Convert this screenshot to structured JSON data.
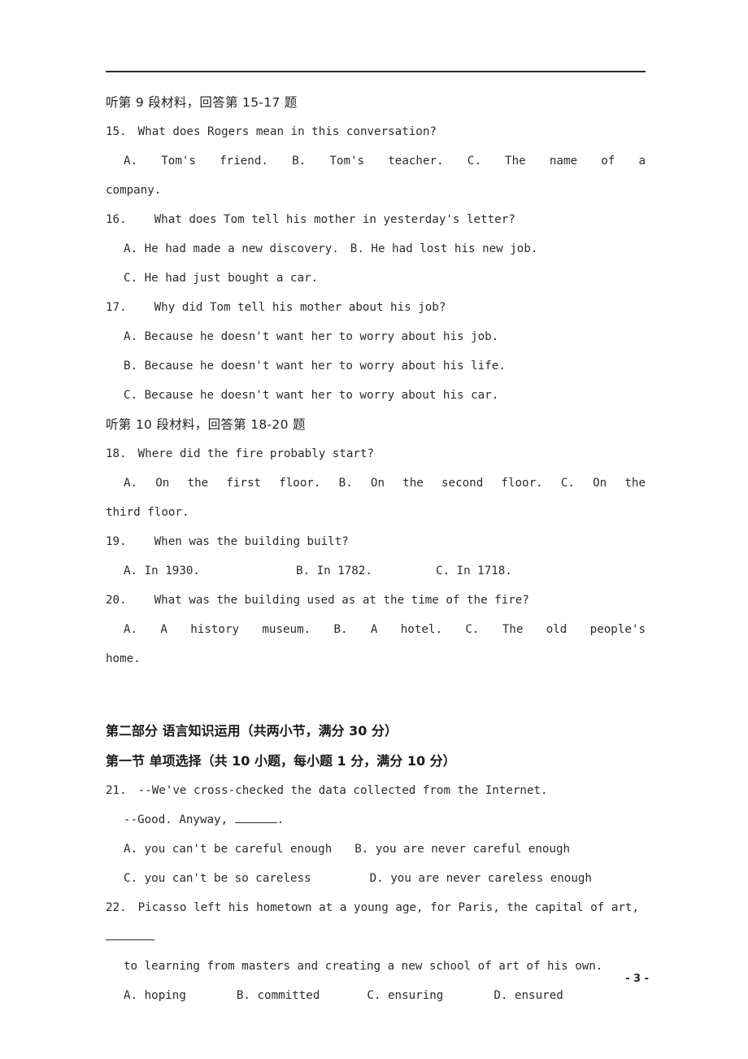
{
  "document": {
    "type": "english-exam-paper",
    "page_number": "- 3 -"
  },
  "listening": {
    "section_9": {
      "heading": "听第 9 段材料，回答第 15-17 题",
      "questions": [
        {
          "number": "15.",
          "stem": "What does Rogers mean in this conversation?",
          "options_line1": [
            "A. Tom's friend.",
            "B. Tom's teacher.",
            "C. The name of a"
          ],
          "options_wrap": "company."
        },
        {
          "number": "16.",
          "stem": "What does Tom tell his mother in yesterday's letter?",
          "options_line1": [
            "A. He had made a new discovery.",
            "B. He had lost his new job."
          ],
          "options_line2": [
            "C. He had just bought a car."
          ]
        },
        {
          "number": "17.",
          "stem": "Why did Tom tell his mother about his job?",
          "option_a": "A. Because he doesn't want her to worry about his job.",
          "option_b": "B. Because he doesn't want her to worry about his life.",
          "option_c": "C. Because he doesn't want her to worry about his car."
        }
      ]
    },
    "section_10": {
      "heading": "听第 10 段材料，回答第 18-20 题",
      "questions": [
        {
          "number": "18.",
          "stem": "Where did the fire probably start?",
          "options_line1": [
            "A. On the first floor.",
            "B. On the second floor.",
            "C.   On   the"
          ],
          "options_wrap": "third floor."
        },
        {
          "number": "19.",
          "stem": "When was the building built?",
          "options_line1": [
            "A. In 1930.",
            "B. In 1782.",
            "C. In 1718."
          ]
        },
        {
          "number": "20.",
          "stem": "What was the building used as at the time of the fire?",
          "options_line1": [
            "A. A history museum.",
            "B. A hotel.",
            "C. The old people's"
          ],
          "options_wrap": "home."
        }
      ]
    }
  },
  "part_two": {
    "heading": "第二部分 语言知识运用（共两小节，满分 30 分）",
    "section_one_heading": "第一节 单项选择（共 10 小题，每小题 1 分，满分 10 分）",
    "questions": [
      {
        "number": "21.",
        "stem_line1": "--We've cross-checked the data collected from the Internet.",
        "stem_line2_pre": "--Good. Anyway, ",
        "stem_line2_post": ".",
        "option_a": "A. you can't be careful enough",
        "option_b": "B. you are never careful enough",
        "option_c": "C. you can't be so careless",
        "option_d": "D. you are never careless enough"
      },
      {
        "number": "22.",
        "stem_line1": "Picasso left his hometown at a young age, for Paris, the capital of art,",
        "stem_line2": "to learning from masters and creating a new school of art of his own.",
        "option_a": "A. hoping",
        "option_b": "B. committed",
        "option_c": "C. ensuring",
        "option_d": "D. ensured"
      }
    ]
  }
}
